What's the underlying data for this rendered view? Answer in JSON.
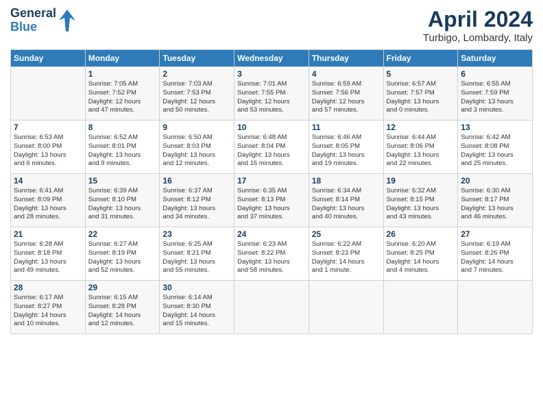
{
  "header": {
    "logo_line1": "General",
    "logo_line2": "Blue",
    "month": "April 2024",
    "location": "Turbigo, Lombardy, Italy"
  },
  "days_of_week": [
    "Sunday",
    "Monday",
    "Tuesday",
    "Wednesday",
    "Thursday",
    "Friday",
    "Saturday"
  ],
  "weeks": [
    [
      {
        "day": "",
        "text": ""
      },
      {
        "day": "1",
        "text": "Sunrise: 7:05 AM\nSunset: 7:52 PM\nDaylight: 12 hours\nand 47 minutes."
      },
      {
        "day": "2",
        "text": "Sunrise: 7:03 AM\nSunset: 7:53 PM\nDaylight: 12 hours\nand 50 minutes."
      },
      {
        "day": "3",
        "text": "Sunrise: 7:01 AM\nSunset: 7:55 PM\nDaylight: 12 hours\nand 53 minutes."
      },
      {
        "day": "4",
        "text": "Sunrise: 6:59 AM\nSunset: 7:56 PM\nDaylight: 12 hours\nand 57 minutes."
      },
      {
        "day": "5",
        "text": "Sunrise: 6:57 AM\nSunset: 7:57 PM\nDaylight: 13 hours\nand 0 minutes."
      },
      {
        "day": "6",
        "text": "Sunrise: 6:55 AM\nSunset: 7:59 PM\nDaylight: 13 hours\nand 3 minutes."
      }
    ],
    [
      {
        "day": "7",
        "text": "Sunrise: 6:53 AM\nSunset: 8:00 PM\nDaylight: 13 hours\nand 6 minutes."
      },
      {
        "day": "8",
        "text": "Sunrise: 6:52 AM\nSunset: 8:01 PM\nDaylight: 13 hours\nand 9 minutes."
      },
      {
        "day": "9",
        "text": "Sunrise: 6:50 AM\nSunset: 8:03 PM\nDaylight: 13 hours\nand 12 minutes."
      },
      {
        "day": "10",
        "text": "Sunrise: 6:48 AM\nSunset: 8:04 PM\nDaylight: 13 hours\nand 16 minutes."
      },
      {
        "day": "11",
        "text": "Sunrise: 6:46 AM\nSunset: 8:05 PM\nDaylight: 13 hours\nand 19 minutes."
      },
      {
        "day": "12",
        "text": "Sunrise: 6:44 AM\nSunset: 8:06 PM\nDaylight: 13 hours\nand 22 minutes."
      },
      {
        "day": "13",
        "text": "Sunrise: 6:42 AM\nSunset: 8:08 PM\nDaylight: 13 hours\nand 25 minutes."
      }
    ],
    [
      {
        "day": "14",
        "text": "Sunrise: 6:41 AM\nSunset: 8:09 PM\nDaylight: 13 hours\nand 28 minutes."
      },
      {
        "day": "15",
        "text": "Sunrise: 6:39 AM\nSunset: 8:10 PM\nDaylight: 13 hours\nand 31 minutes."
      },
      {
        "day": "16",
        "text": "Sunrise: 6:37 AM\nSunset: 8:12 PM\nDaylight: 13 hours\nand 34 minutes."
      },
      {
        "day": "17",
        "text": "Sunrise: 6:35 AM\nSunset: 8:13 PM\nDaylight: 13 hours\nand 37 minutes."
      },
      {
        "day": "18",
        "text": "Sunrise: 6:34 AM\nSunset: 8:14 PM\nDaylight: 13 hours\nand 40 minutes."
      },
      {
        "day": "19",
        "text": "Sunrise: 6:32 AM\nSunset: 8:15 PM\nDaylight: 13 hours\nand 43 minutes."
      },
      {
        "day": "20",
        "text": "Sunrise: 6:30 AM\nSunset: 8:17 PM\nDaylight: 13 hours\nand 46 minutes."
      }
    ],
    [
      {
        "day": "21",
        "text": "Sunrise: 6:28 AM\nSunset: 8:18 PM\nDaylight: 13 hours\nand 49 minutes."
      },
      {
        "day": "22",
        "text": "Sunrise: 6:27 AM\nSunset: 8:19 PM\nDaylight: 13 hours\nand 52 minutes."
      },
      {
        "day": "23",
        "text": "Sunrise: 6:25 AM\nSunset: 8:21 PM\nDaylight: 13 hours\nand 55 minutes."
      },
      {
        "day": "24",
        "text": "Sunrise: 6:23 AM\nSunset: 8:22 PM\nDaylight: 13 hours\nand 58 minutes."
      },
      {
        "day": "25",
        "text": "Sunrise: 6:22 AM\nSunset: 8:23 PM\nDaylight: 14 hours\nand 1 minute."
      },
      {
        "day": "26",
        "text": "Sunrise: 6:20 AM\nSunset: 8:25 PM\nDaylight: 14 hours\nand 4 minutes."
      },
      {
        "day": "27",
        "text": "Sunrise: 6:19 AM\nSunset: 8:26 PM\nDaylight: 14 hours\nand 7 minutes."
      }
    ],
    [
      {
        "day": "28",
        "text": "Sunrise: 6:17 AM\nSunset: 8:27 PM\nDaylight: 14 hours\nand 10 minutes."
      },
      {
        "day": "29",
        "text": "Sunrise: 6:15 AM\nSunset: 8:28 PM\nDaylight: 14 hours\nand 12 minutes."
      },
      {
        "day": "30",
        "text": "Sunrise: 6:14 AM\nSunset: 8:30 PM\nDaylight: 14 hours\nand 15 minutes."
      },
      {
        "day": "",
        "text": ""
      },
      {
        "day": "",
        "text": ""
      },
      {
        "day": "",
        "text": ""
      },
      {
        "day": "",
        "text": ""
      }
    ]
  ]
}
